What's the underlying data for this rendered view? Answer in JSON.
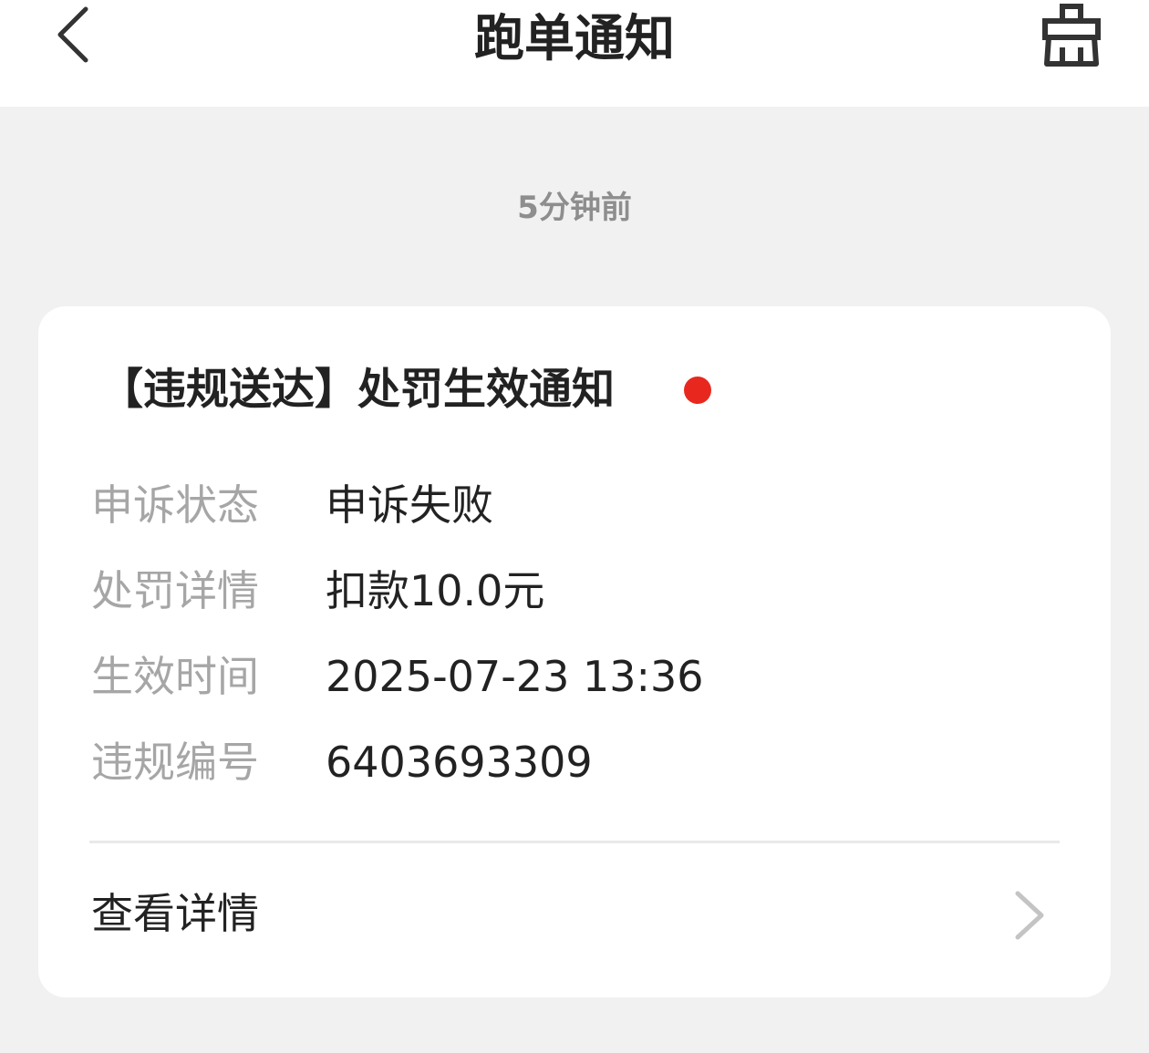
{
  "header": {
    "title": "跑单通知",
    "back_icon": "chevron-left-icon",
    "action_icon": "broom-clean-icon"
  },
  "feed": {
    "time_label": "5分钟前"
  },
  "notification": {
    "title": "【违规送达】处罚生效通知",
    "unread": true,
    "fields": [
      {
        "label": "申诉状态",
        "value": "申诉失败"
      },
      {
        "label": "处罚详情",
        "value": "扣款10.0元"
      },
      {
        "label": "生效时间",
        "value": "2025-07-23 13:36"
      },
      {
        "label": "违规编号",
        "value": "6403693309"
      }
    ],
    "details_label": "查看详情"
  },
  "colors": {
    "background": "#f1f1f1",
    "card": "#ffffff",
    "unread_dot": "#e8281e",
    "label_text": "#a6a6a6",
    "value_text": "#222222"
  }
}
